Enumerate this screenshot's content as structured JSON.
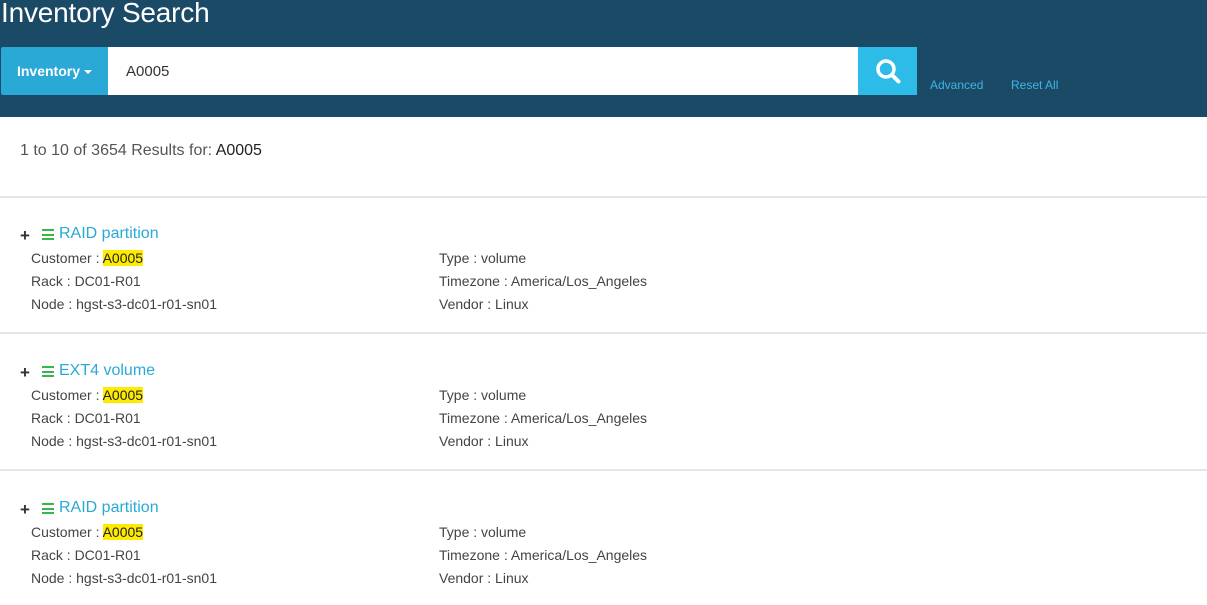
{
  "header": {
    "title": "Inventory Search",
    "category_label": "Inventory",
    "search_value": "A0005",
    "advanced_label": "Advanced",
    "reset_label": "Reset All"
  },
  "summary": {
    "text": "1 to 10 of 3654 Results for:",
    "query": "A0005"
  },
  "colors": {
    "header_bg": "#1b4a66",
    "accent": "#2aa9d6",
    "highlight": "#ffeb00",
    "list_icon": "#3ab54a"
  },
  "results": [
    {
      "expand_symbol": "+",
      "title": "RAID partition",
      "customer_label": "Customer :",
      "customer_value": "A0005",
      "rack": "Rack : DC01-R01",
      "node": "Node : hgst-s3-dc01-r01-sn01",
      "type": "Type : volume",
      "timezone": "Timezone : America/Los_Angeles",
      "vendor": "Vendor : Linux"
    },
    {
      "expand_symbol": "+",
      "title": "EXT4 volume",
      "customer_label": "Customer :",
      "customer_value": "A0005",
      "rack": "Rack : DC01-R01",
      "node": "Node : hgst-s3-dc01-r01-sn01",
      "type": "Type : volume",
      "timezone": "Timezone : America/Los_Angeles",
      "vendor": "Vendor : Linux"
    },
    {
      "expand_symbol": "+",
      "title": "RAID partition",
      "customer_label": "Customer :",
      "customer_value": "A0005",
      "rack": "Rack : DC01-R01",
      "node": "Node : hgst-s3-dc01-r01-sn01",
      "type": "Type : volume",
      "timezone": "Timezone : America/Los_Angeles",
      "vendor": "Vendor : Linux"
    }
  ]
}
